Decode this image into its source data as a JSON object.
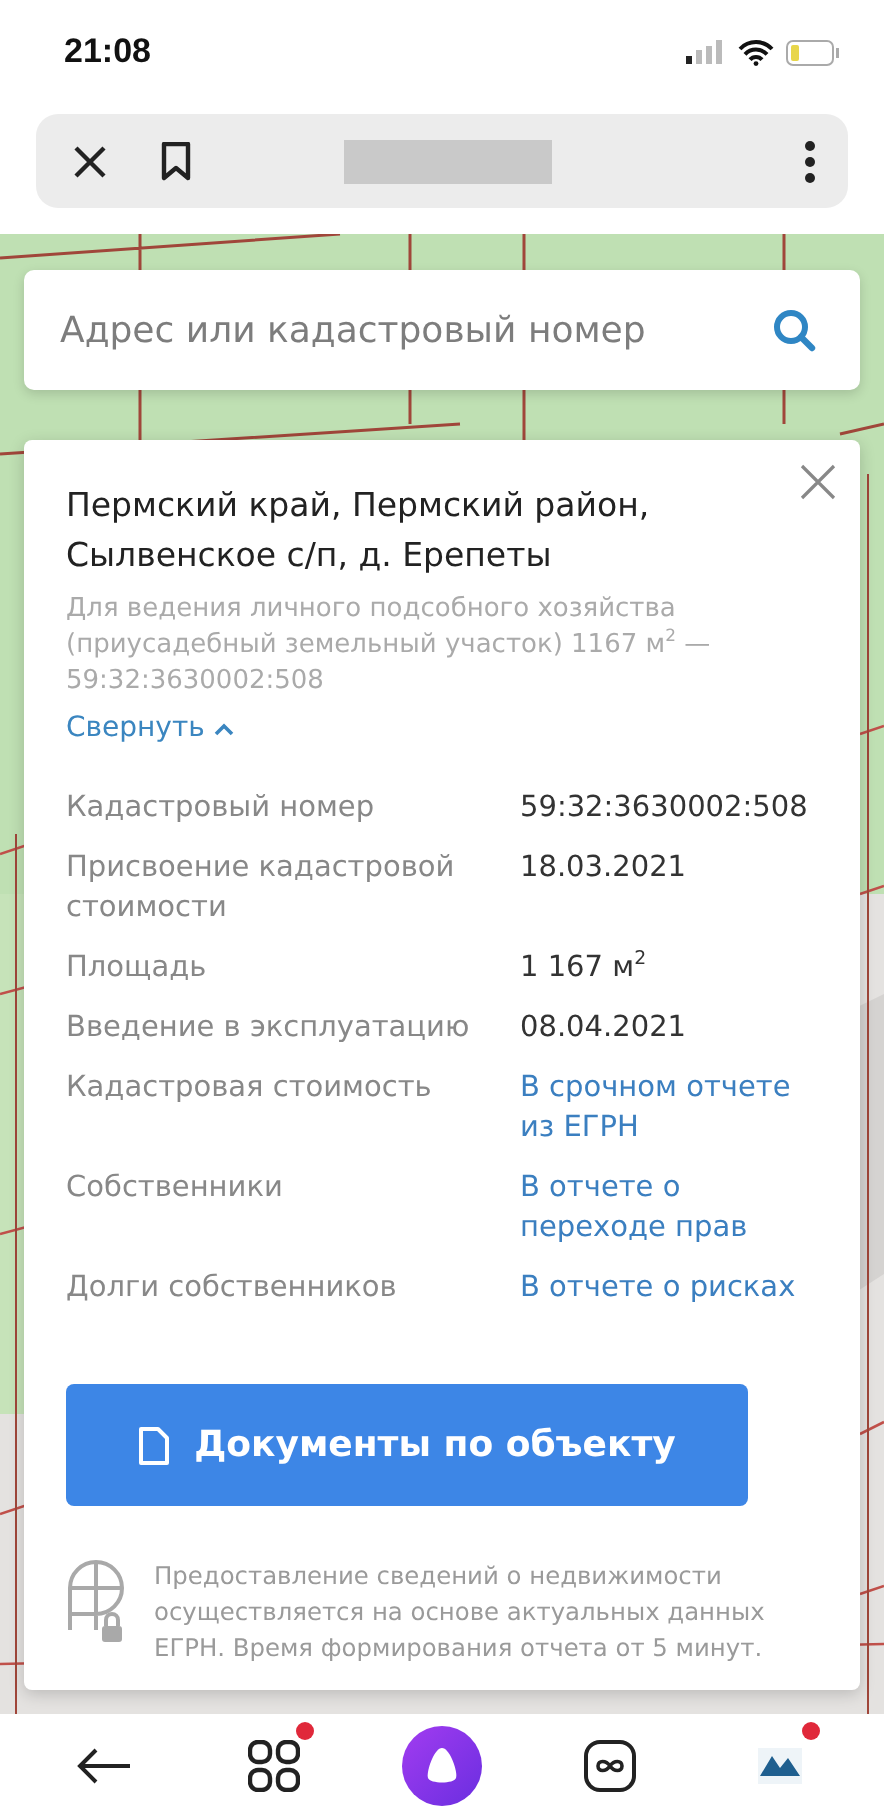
{
  "status_bar": {
    "time": "21:08"
  },
  "search": {
    "placeholder": "Адрес или кадастровый номер"
  },
  "card": {
    "title": "Пермский край, Пермский район, Сылвенское с/п, д. Ерепеты",
    "subtitle": "Для ведения личного подсобного хозяйства (приусадебный земельный участок) 1167 м$^{2}$ — 59:32:3630002:508",
    "collapse": {
      "label": "Свернуть",
      "expanded": true
    },
    "rows": [
      {
        "label": "Кадастровый номер",
        "value": "59:32:3630002:508",
        "kind": "text"
      },
      {
        "label": "Присвоение кадастровой стоимости",
        "value": "18.03.2021",
        "kind": "text"
      },
      {
        "label": "Площадь",
        "value": "1 167 м$^{2}$",
        "kind": "text"
      },
      {
        "label": "Введение в эксплуатацию",
        "value": "08.04.2021",
        "kind": "text"
      },
      {
        "label": "Кадастровая стоимость",
        "value": "В срочном отчете из ЕГРН",
        "kind": "link"
      },
      {
        "label": "Собственники",
        "value": "В отчете о переходе прав",
        "kind": "link"
      },
      {
        "label": "Долги собственников",
        "value": "В отчете о рисках",
        "kind": "link"
      }
    ],
    "button": "Документы по объекту",
    "note": "Предоставление сведений о недвижимости осуществляется на основе актуальных данных ЕГРН. Время формирования отчета от 5 минут."
  },
  "bottom_nav": [
    {
      "kind": "back",
      "badge": false
    },
    {
      "kind": "apps",
      "badge": true
    },
    {
      "kind": "assistant",
      "badge": false
    },
    {
      "kind": "loop",
      "badge": false
    },
    {
      "kind": "app",
      "badge": true
    }
  ]
}
